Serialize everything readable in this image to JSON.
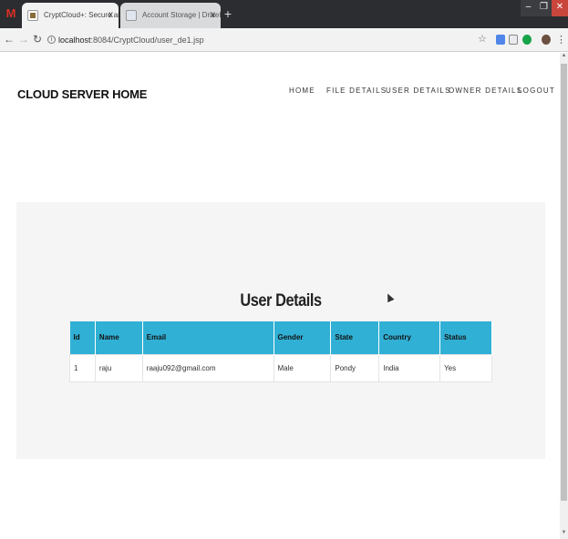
{
  "browser": {
    "tabs": [
      {
        "title": "CryptCloud+: Secure and Expressive",
        "active": true
      },
      {
        "title": "Account Storage | DriveHQ",
        "active": false
      }
    ],
    "url_host": "localhost",
    "url_rest": ":8084/CryptCloud/user_de1.jsp",
    "window_controls": {
      "minimize": "–",
      "maximize": "❐",
      "close": "✕"
    }
  },
  "site": {
    "title": "CLOUD SERVER HOME",
    "nav": [
      "HOME",
      "FILE DETAILS",
      "USER DETAILS",
      "OWNER DETAILS",
      "LOGOUT"
    ]
  },
  "main": {
    "heading": "User Details",
    "table": {
      "headers": [
        "Id",
        "Name",
        "Email",
        "Gender",
        "State",
        "Country",
        "Status"
      ],
      "rows": [
        [
          "1",
          "raju",
          "raaju092@gmail.com",
          "Male",
          "Pondy",
          "India",
          "Yes"
        ]
      ]
    }
  },
  "colors": {
    "table_header": "#31b0d5",
    "panel_bg": "#f5f5f5",
    "tabbar_bg": "#2b2d30"
  }
}
